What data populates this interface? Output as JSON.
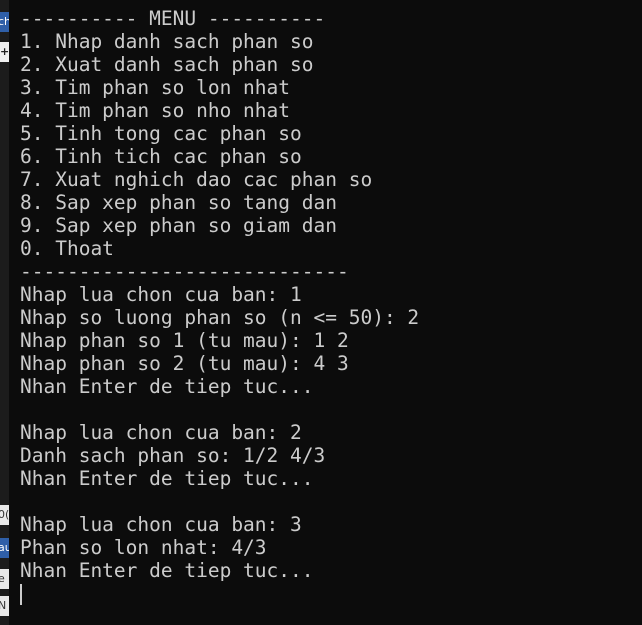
{
  "sidebar_fragments": [
    {
      "text": "ch",
      "style": "blue"
    },
    {
      "text": "+",
      "style": "plus"
    },
    {
      "text": "0(",
      "style": "light"
    },
    {
      "text": "au",
      "style": "blue"
    },
    {
      "text": "e",
      "style": "light"
    },
    {
      "text": "N",
      "style": "light"
    }
  ],
  "terminal": {
    "lines": [
      "---------- MENU ----------",
      "1. Nhap danh sach phan so",
      "2. Xuat danh sach phan so",
      "3. Tim phan so lon nhat",
      "4. Tim phan so nho nhat",
      "5. Tinh tong cac phan so",
      "6. Tinh tich cac phan so",
      "7. Xuat nghich dao cac phan so",
      "8. Sap xep phan so tang dan",
      "9. Sap xep phan so giam dan",
      "0. Thoat",
      "----------------------------",
      "Nhap lua chon cua ban: 1",
      "Nhap so luong phan so (n <= 50): 2",
      "Nhap phan so 1 (tu mau): 1 2",
      "Nhap phan so 2 (tu mau): 4 3",
      "Nhan Enter de tiep tuc...",
      "",
      "Nhap lua chon cua ban: 2",
      "Danh sach phan so: 1/2 4/3",
      "Nhan Enter de tiep tuc...",
      "",
      "Nhap lua chon cua ban: 3",
      "Phan so lon nhat: 4/3",
      "Nhan Enter de tiep tuc...",
      ""
    ]
  },
  "colors": {
    "background": "#0c0c0c",
    "text": "#cccccc"
  }
}
